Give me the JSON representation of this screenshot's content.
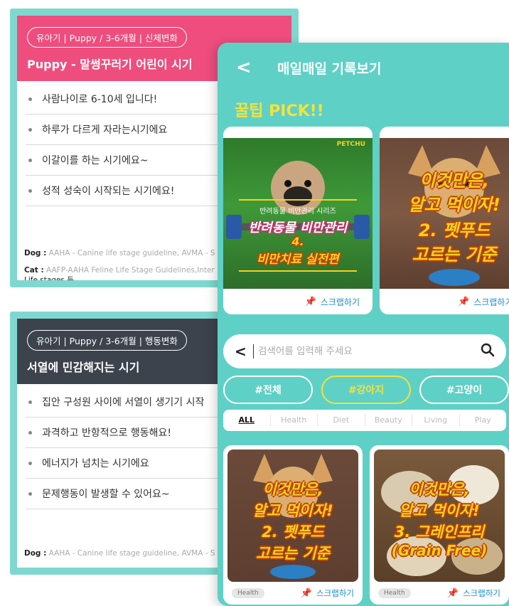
{
  "left_cards": [
    {
      "tag": "유아기 | Puppy / 3-6개월 | 신체변화",
      "title": "Puppy - 말썽꾸러기 어린이 시기",
      "bullets": [
        "사람나이로 6-10세 입니다!",
        "하루가 다르게 자라는시기에요",
        "이갈이를 하는 시기에요~",
        "성적 성숙이 시작되는 시기에요!"
      ],
      "dog_label": "Dog :",
      "dog_src": "AAHA - Canine life stage guideline, AVMA - S",
      "cat_label": "Cat :",
      "cat_src": "AAFP-AAHA Feline Life Stage Guidelines,Inter",
      "cat_src2": "Life stages 등"
    },
    {
      "tag": "유아기 | Puppy / 3-6개월 | 행동변화",
      "title": "서열에 민감해지는 시기",
      "bullets": [
        "집안 구성원 사이에 서열이 생기기 시작",
        "과격하고 반항적으로 행동해요!",
        "에너지가 넘치는 시기에요",
        "문제행동이 발생할 수 있어요~"
      ],
      "dog_label": "Dog :",
      "dog_src": "AAHA - Canine life stage guideline, AVMA - S"
    }
  ],
  "header": {
    "back": "<",
    "title": "매일매일 기록보기"
  },
  "tip_section": {
    "label": "꿀팁 PICK!!"
  },
  "tip_cards": [
    {
      "brand": "PETCHU",
      "subtitle": "반려동물 비만관리 시리즈",
      "line1": "반려동물 비만관리",
      "line2": "4.",
      "line3": "비만치료 실전편",
      "scrap": "스크랩하기"
    },
    {
      "line1": "이것만은,",
      "line2": "알고 먹이자!",
      "line3": "2. 펫푸드",
      "line4": "고르는 기준",
      "scrap": "스크랩하기"
    }
  ],
  "search": {
    "back": "<",
    "placeholder": "검색어를 입력해 주세요"
  },
  "categories": [
    {
      "label": "#전체",
      "active": false
    },
    {
      "label": "#강아지",
      "active": true
    },
    {
      "label": "#고양이",
      "active": false
    }
  ],
  "subtabs": [
    {
      "label": "ALL",
      "active": true
    },
    {
      "label": "Health",
      "active": false
    },
    {
      "label": "Diet",
      "active": false
    },
    {
      "label": "Beauty",
      "active": false
    },
    {
      "label": "Living",
      "active": false
    },
    {
      "label": "Play",
      "active": false
    }
  ],
  "grid_cards": [
    {
      "line1": "이것만은,",
      "line2": "알고 먹이자!",
      "line3": "2. 펫푸드",
      "line4": "고르는 기준",
      "badge": "Health",
      "scrap": "스크랩하기"
    },
    {
      "line1": "이것만은,",
      "line2": "알고 먹이자!",
      "line3": "3. 그레인프리",
      "line4": "(Grain Free)",
      "badge": "Health",
      "scrap": "스크랩하기"
    }
  ],
  "colors": {
    "teal": "#5fd0c6",
    "pink": "#ee4d7e",
    "dark": "#3c434c",
    "yellow": "#f4e23a",
    "link": "#1a8dcf"
  }
}
